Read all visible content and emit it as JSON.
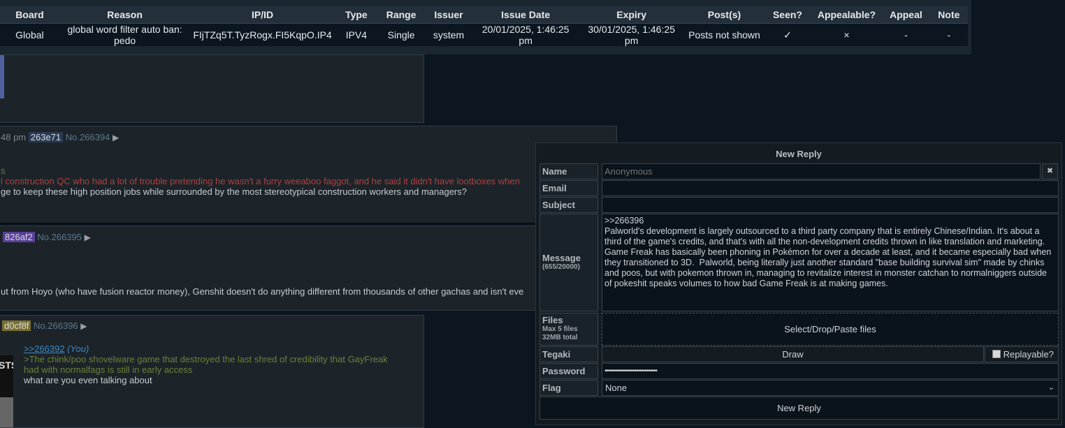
{
  "ban_table": {
    "headers": [
      "Board",
      "Reason",
      "IP/ID",
      "Type",
      "Range",
      "Issuer",
      "Issue Date",
      "Expiry",
      "Post(s)",
      "Seen?",
      "Appealable?",
      "Appeal",
      "Note"
    ],
    "row": [
      "Global",
      "global word filter auto ban: pedo",
      "FIjTZq5T.TyzRogx.FI5KqpO.IP4",
      "IPV4",
      "Single",
      "system",
      "20/01/2025, 1:46:25 pm",
      "30/01/2025, 1:46:25 pm",
      "Posts not shown",
      "✓",
      "×",
      "-",
      "-"
    ]
  },
  "posts": [
    {
      "time_fragment": "48 pm",
      "id": "263e71",
      "id_color": "#2a3a55",
      "number": "No.266394",
      "lines": [
        {
          "text": "s",
          "style": "greentext"
        },
        {
          "text": "l construction QC who had a lot of trouble pretending he wasn't a furry weeaboo faggot, and he said it didn't have lootboxes when",
          "style": "red"
        },
        {
          "text": "ge to keep these high position jobs while surrounded by the most stereotypical construction workers and managers?",
          "style": "normal"
        }
      ]
    },
    {
      "id": "826af2",
      "id_color": "#5a3f9a",
      "number": "No.266395",
      "lines": [
        {
          "text": "ut from Hoyo (who have fusion reactor money), Genshit doesn't do anything different from thousands of other gachas and isn't eve",
          "style": "normal"
        }
      ]
    },
    {
      "id": "d0cf8f",
      "id_color": "#7a7030",
      "number": "No.266396",
      "thumb_text": "STS",
      "quote_link": ">>266392",
      "you": "(You)",
      "greentext": [
        ">The chink/poo shovelware game that destroyed the last shred of credibility that GayFreak",
        "had with normalfags is still in early access"
      ],
      "body": "what are you even talking about"
    }
  ],
  "reply_form": {
    "title": "New Reply",
    "labels": {
      "name": "Name",
      "email": "Email",
      "subject": "Subject",
      "message": "Message",
      "message_count": "(655/20000)",
      "files": "Files",
      "files_note1": "Max 5 files",
      "files_note2": "32MB total",
      "tegaki": "Tegaki",
      "password": "Password",
      "flag": "Flag"
    },
    "name_placeholder": "Anonymous",
    "close_glyph": "✖",
    "message_text": ">>266396\nPalworld's development is largely outsourced to a third party company that is entirely Chinese/Indian. It's about a third of the game's credits, and that's with all the non-development credits thrown in like translation and marketing. Game Freak has basically been phoning in Pokémon for over a decade at least, and it became especially bad when they transitioned to 3D.  Palworld, being literally just another standard \"base building survival sim\" made by chinks and poos, but with pokemon thrown in, managing to revitalize interest in monster catchan to normalniggers outside of pokeshit speaks volumes to how bad Game Freak is at making games.",
    "files_prompt": "Select/Drop/Paste files",
    "draw_label": "Draw",
    "replayable_label": "Replayable?",
    "password_value": "••••••••••••••••••••••••••••••",
    "flag_value": "None",
    "submit_label": "New Reply"
  }
}
